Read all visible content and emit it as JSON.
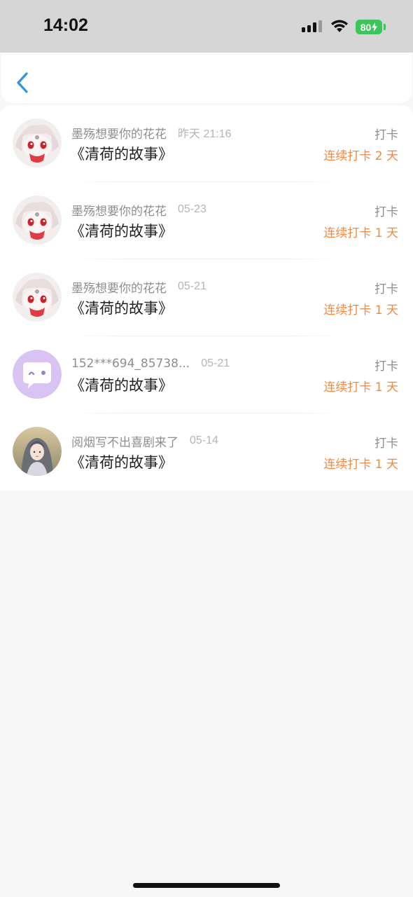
{
  "status_bar": {
    "time": "14:02",
    "battery": "80",
    "icons": [
      "signal-icon",
      "wifi-icon",
      "battery-icon",
      "charging-bolt-icon"
    ]
  },
  "header": {
    "back_icon": "chevron-left-icon",
    "accent_color": "#2f93e0"
  },
  "colors": {
    "streak": "#ef8a45",
    "meta_text": "#8e8e8e",
    "date_text": "#b5b5b5",
    "background": "#f7f7f7"
  },
  "checkins": [
    {
      "username": "墨殇想要你的花花",
      "date": "昨天 21:16",
      "title": "《清荷的故事》",
      "action": "打卡",
      "streak": "连续打卡 2 天",
      "avatar": "anime-avatar"
    },
    {
      "username": "墨殇想要你的花花",
      "date": "05-23",
      "title": "《清荷的故事》",
      "action": "打卡",
      "streak": "连续打卡 1 天",
      "avatar": "anime-avatar"
    },
    {
      "username": "墨殇想要你的花花",
      "date": "05-21",
      "title": "《清荷的故事》",
      "action": "打卡",
      "streak": "连续打卡 1 天",
      "avatar": "anime-avatar"
    },
    {
      "username": "152***694_85738...",
      "date": "05-21",
      "title": "《清荷的故事》",
      "action": "打卡",
      "streak": "连续打卡 1 天",
      "avatar": "default-chat-avatar"
    },
    {
      "username": "阅烟写不出喜剧来了",
      "date": "05-14",
      "title": "《清荷的故事》",
      "action": "打卡",
      "streak": "连续打卡 1 天",
      "avatar": "portrait-avatar"
    }
  ]
}
